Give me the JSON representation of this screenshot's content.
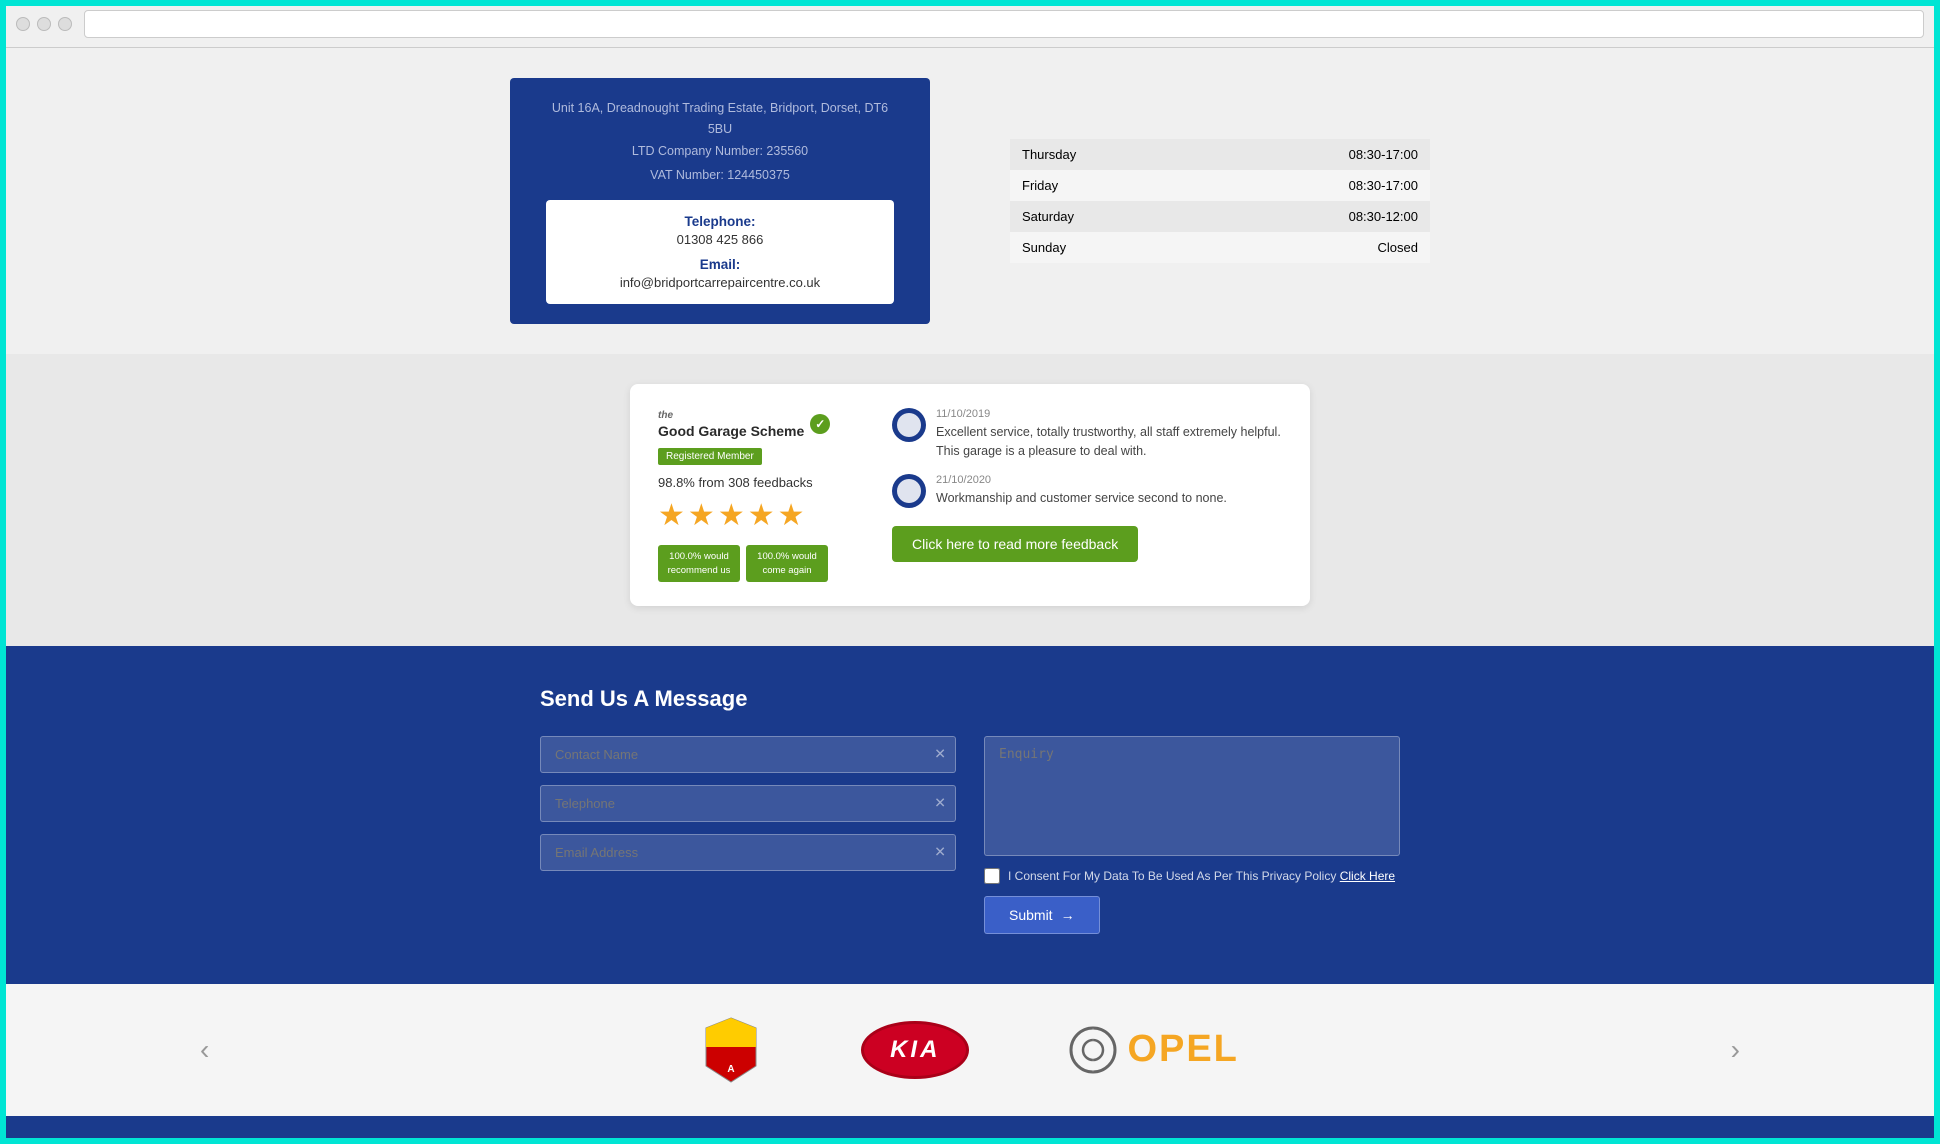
{
  "browser": {
    "dots": [
      "dot1",
      "dot2",
      "dot3"
    ]
  },
  "company": {
    "address_line1": "Unit 16A, Dreadnought Trading Estate, Bridport, Dorset, DT6 5BU",
    "address_line2": "LTD Company Number: 235560",
    "vat": "VAT Number: 124450375",
    "telephone_label": "Telephone:",
    "telephone_value": "01308 425 866",
    "email_label": "Email:",
    "email_value": "info@bridportcarrepaircentre.co.uk"
  },
  "hours": {
    "rows": [
      {
        "day": "Thursday",
        "time": "08:30-17:00"
      },
      {
        "day": "Friday",
        "time": "08:30-17:00"
      },
      {
        "day": "Saturday",
        "time": "08:30-12:00"
      },
      {
        "day": "Sunday",
        "time": "Closed"
      }
    ]
  },
  "feedback": {
    "scheme_name": "the Good Garage Scheme",
    "check_mark": "✓",
    "registered_label": "Registered Member",
    "score_text": "98.8% from 308 feedbacks",
    "recommend_label1": "100.0% would recommend us",
    "recommend_label2": "100.0% would come again",
    "review1_date": "11/10/2019",
    "review1_text": "Excellent service, totally trustworthy, all staff extremely helpful. This garage is a pleasure to deal with.",
    "review2_date": "21/10/2020",
    "review2_text": "Workmanship and customer service second to none.",
    "read_more_btn": "Click here to read more feedback"
  },
  "contact_form": {
    "title": "Send Us A Message",
    "name_placeholder": "Contact Name",
    "telephone_placeholder": "Telephone",
    "email_placeholder": "Email Address",
    "enquiry_placeholder": "Enquiry",
    "consent_text": "I Consent For My Data To Be Used As Per This Privacy Policy",
    "consent_link": "Click Here",
    "submit_label": "Submit",
    "submit_arrow": "→"
  },
  "logos": {
    "prev_arrow": "‹",
    "next_arrow": "›",
    "brands": [
      "Abarth",
      "KIA",
      "Opel"
    ]
  }
}
